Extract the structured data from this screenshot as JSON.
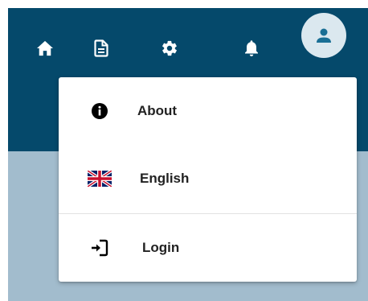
{
  "colors": {
    "header_bg": "#05496b",
    "body_bg": "#a2bccd",
    "avatar_bg": "#dbe8ef",
    "avatar_icon": "#1a6f95",
    "menu_text": "#222222"
  },
  "nav": {
    "icons": [
      "home-icon",
      "document-icon",
      "gear-icon",
      "bell-icon",
      "user-icon"
    ]
  },
  "menu": {
    "items": [
      {
        "label": "About",
        "icon": "info-icon"
      },
      {
        "label": "English",
        "icon": "uk-flag-icon"
      },
      {
        "label": "Login",
        "icon": "login-icon"
      }
    ]
  }
}
